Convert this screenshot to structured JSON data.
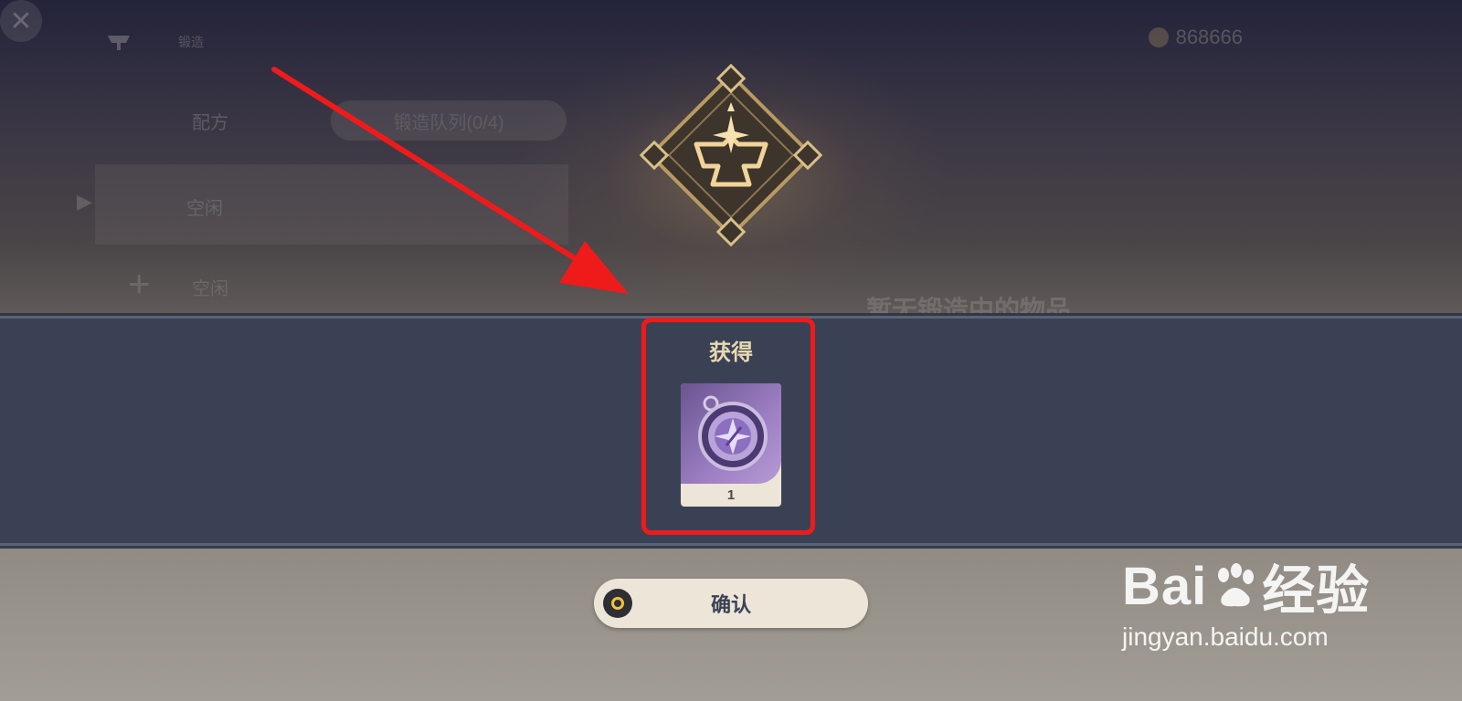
{
  "background_ui": {
    "title": "锻造",
    "currency_value": "868666",
    "close_glyph": "✕",
    "tab_recipe": "配方",
    "tab_queue": "锻造队列(0/4)",
    "slot_1_label": "空闲",
    "slot_2_label": "空闲",
    "plus_glyph": "+",
    "arrow_glyph": "▶",
    "empty_message": "暂无锻造中的物品"
  },
  "reward_popup": {
    "title": "获得",
    "items": [
      {
        "name": "purple-compass-item",
        "icon": "compass-icon",
        "count": "1"
      }
    ],
    "confirm_label": "确认"
  },
  "watermark": {
    "brand": "Bai",
    "brand_suffix": "经验",
    "url": "jingyan.baidu.com"
  },
  "colors": {
    "annotation": "#ef1b1b",
    "band": "#3b4155",
    "accent_gold": "#f0c23c",
    "title_gold": "#e8d9b0"
  }
}
